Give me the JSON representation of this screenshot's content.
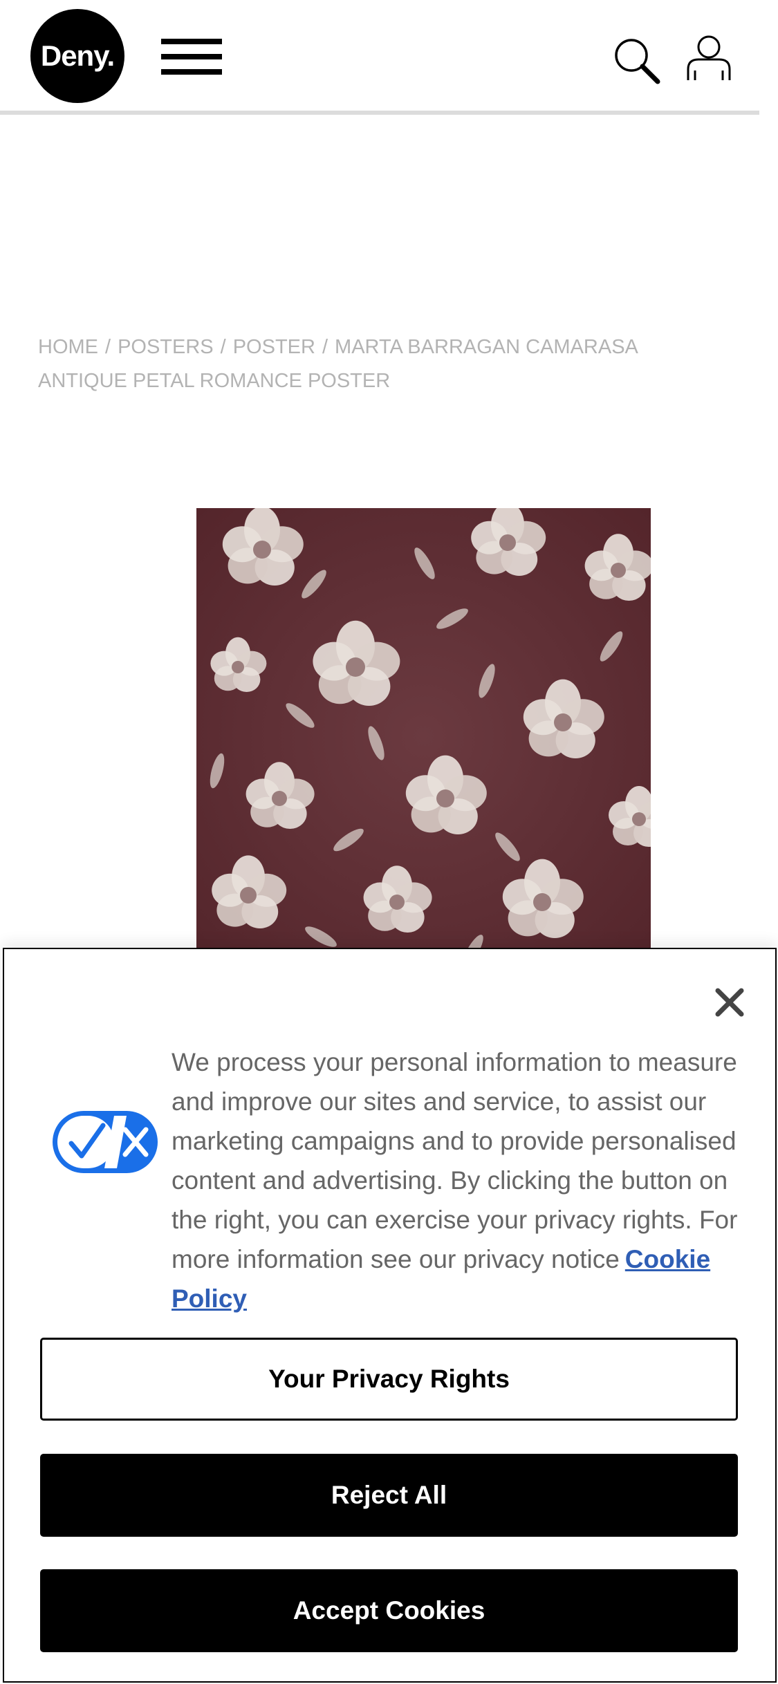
{
  "header": {
    "logo_text": "Deny.",
    "menu_icon": "hamburger-menu-icon",
    "search_icon": "search-icon",
    "account_icon": "user-account-icon"
  },
  "breadcrumb": {
    "items": [
      "HOME",
      "POSTERS",
      "POSTER",
      "MARTA BARRAGAN CAMARASA ANTIQUE PETAL ROMANCE POSTER"
    ],
    "separator": "/"
  },
  "product": {
    "image_description_icon": "floral-poster-image",
    "background_color": "#5e2d33",
    "flower_color": "#e8e0da"
  },
  "cookie_banner": {
    "close_icon": "close-icon",
    "toggle_icon": "privacy-toggle-icon",
    "message": "We process your personal information to measure and improve our sites and service, to assist our marketing campaigns and to provide personalised content and advertising. By clicking the button on the right, you can exercise your privacy rights. For more information see our privacy notice",
    "policy_link": "Cookie Policy",
    "privacy_rights_label": "Your Privacy Rights",
    "reject_label": "Reject All",
    "accept_label": "Accept Cookies",
    "link_color": "#2f5eb5",
    "toggle_color": "#1a6fe8"
  }
}
